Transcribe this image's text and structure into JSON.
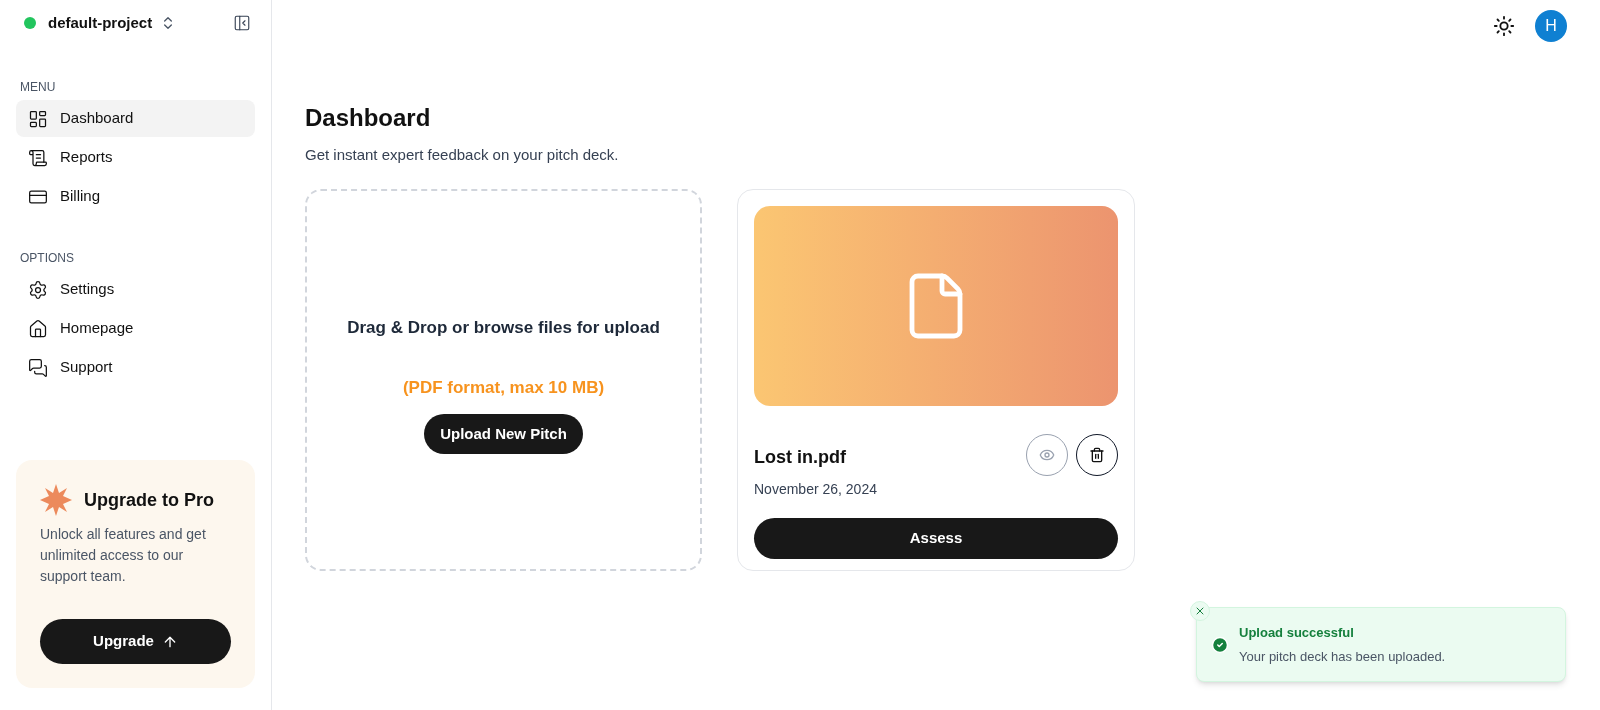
{
  "project": {
    "name": "default-project"
  },
  "sections": [
    {
      "heading": "MENU",
      "items": [
        {
          "label": "Dashboard",
          "selected": true
        },
        {
          "label": "Reports",
          "selected": false
        },
        {
          "label": "Billing",
          "selected": false
        }
      ]
    },
    {
      "heading": "OPTIONS",
      "items": [
        {
          "label": "Settings",
          "selected": false
        },
        {
          "label": "Homepage",
          "selected": false
        },
        {
          "label": "Support",
          "selected": false
        }
      ]
    }
  ],
  "upgrade": {
    "title": "Upgrade to Pro",
    "text": "Unlock all features and get unlimited access to our support team.",
    "button": "Upgrade"
  },
  "header": {
    "avatar": "H"
  },
  "page": {
    "title": "Dashboard",
    "subtitle": "Get instant expert feedback on your pitch deck."
  },
  "dropzone": {
    "text": "Drag & Drop or browse files for upload",
    "hint": "(PDF format, max 10 MB)",
    "button": "Upload New Pitch"
  },
  "files": [
    {
      "name": "Lost in.pdf",
      "date": "November 26, 2024",
      "view_disabled": true,
      "button": "Assess"
    }
  ],
  "toast": {
    "title": "Upload successful",
    "message": "Your pitch deck has been uploaded."
  }
}
